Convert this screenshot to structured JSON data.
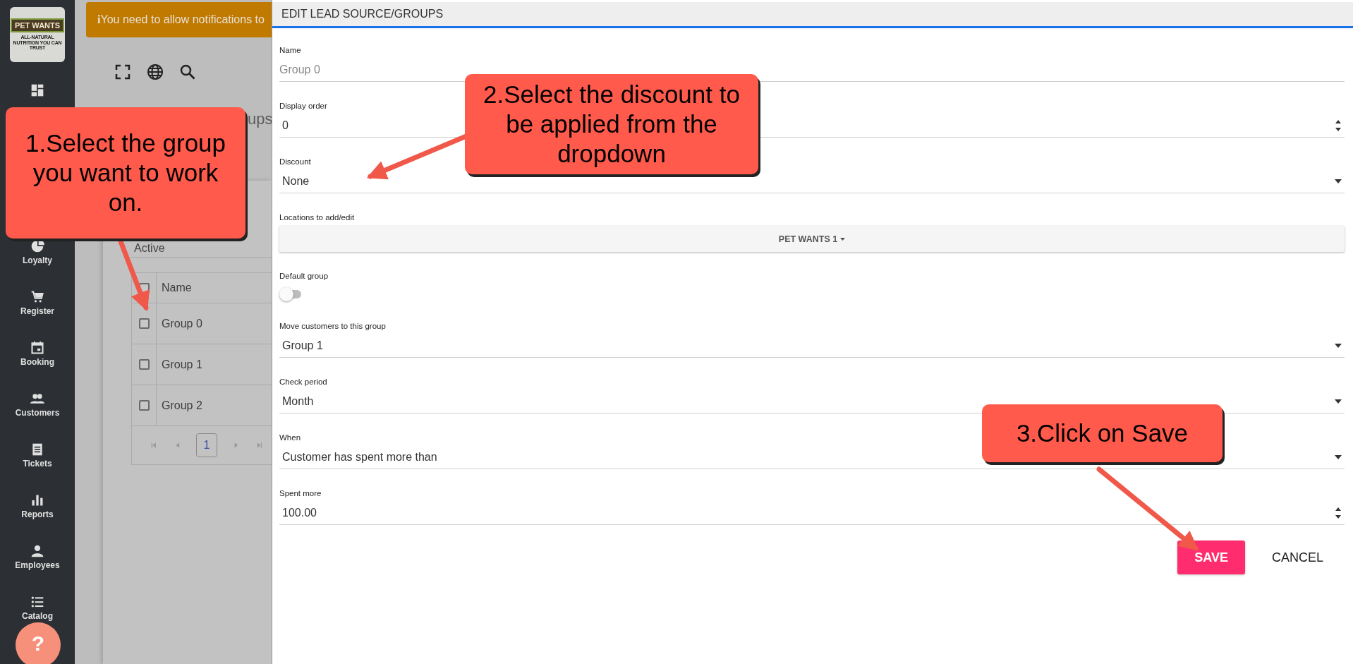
{
  "logo": {
    "name": "PET WANTS",
    "tagline": "ALL-NATURAL NUTRITION YOU CAN TRUST"
  },
  "sidebar": {
    "items": [
      {
        "label": "Loyalty"
      },
      {
        "label": "Register"
      },
      {
        "label": "Booking"
      },
      {
        "label": "Customers"
      },
      {
        "label": "Tickets"
      },
      {
        "label": "Reports"
      },
      {
        "label": "Employees"
      },
      {
        "label": "Catalog"
      }
    ]
  },
  "help_button": {
    "label": "?"
  },
  "banner": {
    "icon_text": "i",
    "text": "You need to allow notifications to"
  },
  "page_heading": "ups",
  "list_card": {
    "tab": "Active",
    "column": "Name",
    "select_all_checked": false,
    "rows": [
      {
        "name": "Group 0",
        "checked": false
      },
      {
        "name": "Group 1",
        "checked": false
      },
      {
        "name": "Group 2",
        "checked": false
      }
    ],
    "pages": [
      {
        "label": "1",
        "selected": true
      }
    ]
  },
  "dialog": {
    "title": "EDIT LEAD SOURCE/GROUPS",
    "fields": [
      {
        "kind": "text",
        "label": "Name",
        "value": "Group 0",
        "disabled": true
      },
      {
        "kind": "number",
        "label": "Display order",
        "value": "0",
        "disabled": false
      },
      {
        "kind": "select",
        "label": "Discount",
        "value": "None",
        "disabled": false
      },
      {
        "kind": "button",
        "label": "Locations to add/edit",
        "value": "PET WANTS 1"
      },
      {
        "kind": "toggle",
        "label": "Default group",
        "on": false
      },
      {
        "kind": "select",
        "label": "Move customers to this group",
        "value": "Group 1",
        "disabled": false
      },
      {
        "kind": "select",
        "label": "Check period",
        "value": "Month",
        "disabled": false
      },
      {
        "kind": "select",
        "label": "When",
        "value": "Customer has spent more than",
        "disabled": false
      },
      {
        "kind": "number",
        "label": "Spent more",
        "value": "100.00",
        "disabled": false
      }
    ],
    "buttons": [
      {
        "kind": "primary",
        "label": "SAVE"
      },
      {
        "kind": "flat",
        "label": "CANCEL"
      }
    ]
  },
  "callouts": [
    {
      "text": "1.Select the group you want to work on."
    },
    {
      "text": "2.Select the discount to be applied from the dropdown"
    },
    {
      "text": "3.Click on Save"
    }
  ]
}
